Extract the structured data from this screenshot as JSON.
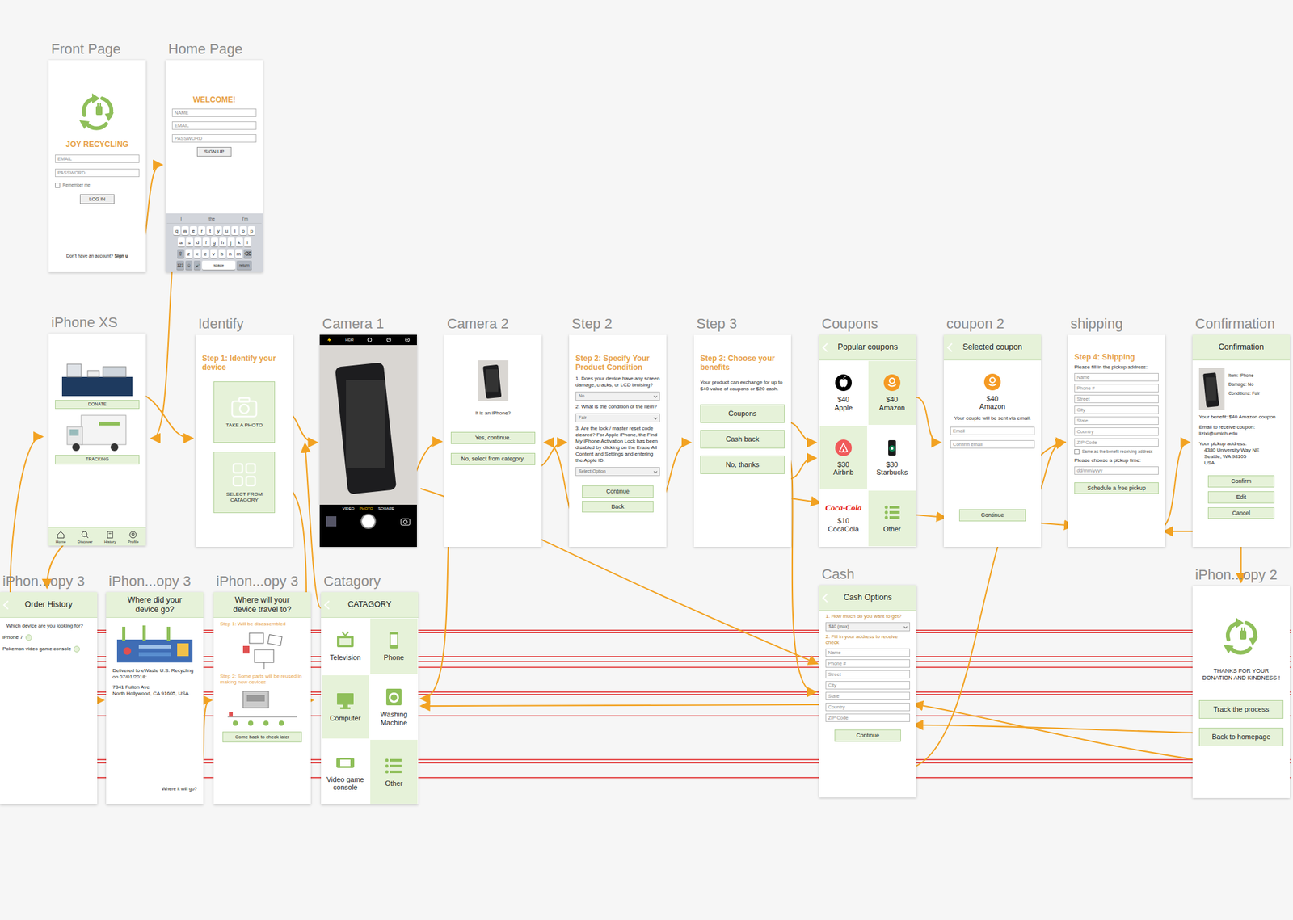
{
  "canvas": {
    "artboards": [
      {
        "label": "Front Page",
        "blocks": [
          {
            "kind": "logo"
          },
          {
            "kind": "heading",
            "text": "JOY RECYCLING"
          },
          {
            "kind": "input",
            "placeholder": "EMAIL"
          },
          {
            "kind": "input",
            "placeholder": "PASSWORD"
          },
          {
            "kind": "checkbox",
            "text": "Remember me",
            "checked": false
          },
          {
            "kind": "button",
            "text": "LOG IN"
          },
          {
            "kind": "link",
            "text": "Don't have an account? ",
            "strong": "Sign u"
          }
        ]
      },
      {
        "label": "Home Page",
        "blocks": [
          {
            "kind": "heading",
            "text": "WELCOME!"
          },
          {
            "kind": "input",
            "placeholder": "NAME"
          },
          {
            "kind": "input",
            "placeholder": "EMAIL"
          },
          {
            "kind": "input",
            "placeholder": "PASSWORD"
          },
          {
            "kind": "button",
            "text": "SIGN UP"
          },
          {
            "kind": "keyboard",
            "suggestions": [
              "I",
              "the",
              "I'm"
            ],
            "rows": [
              [
                "q",
                "w",
                "e",
                "r",
                "t",
                "y",
                "u",
                "i",
                "o",
                "p"
              ],
              [
                "a",
                "s",
                "d",
                "f",
                "g",
                "h",
                "j",
                "k",
                "l"
              ],
              [
                "⇧",
                "z",
                "x",
                "c",
                "v",
                "b",
                "n",
                "m",
                "⌫"
              ]
            ],
            "bottom": [
              "123",
              "☺",
              "🎤",
              "space",
              "return"
            ]
          }
        ]
      },
      {
        "label": "iPhone XS",
        "blocks": [
          {
            "kind": "illustration"
          },
          {
            "kind": "button",
            "text": "DONATE"
          },
          {
            "kind": "illustration"
          },
          {
            "kind": "button",
            "text": "TRACKING"
          },
          {
            "kind": "tabbar",
            "items": [
              "Home",
              "Discover",
              "History",
              "Profile"
            ]
          }
        ]
      },
      {
        "label": "Identify",
        "blocks": [
          {
            "kind": "heading",
            "text": "Step 1: Identify your device"
          },
          {
            "kind": "tile",
            "text": "TAKE A PHOTO"
          },
          {
            "kind": "tile",
            "text": "SELECT FROM CATAGORY"
          }
        ]
      },
      {
        "label": "Camera 1",
        "blocks": [
          {
            "kind": "camera",
            "hdr": "HDR",
            "modes": [
              {
                "label": "VIDEO",
                "selected": false
              },
              {
                "label": "PHOTO",
                "selected": true
              },
              {
                "label": "SQUARE",
                "selected": false
              }
            ]
          }
        ]
      },
      {
        "label": "Camera 2",
        "blocks": [
          {
            "kind": "photo"
          },
          {
            "kind": "text",
            "text": "It is an iPhone?"
          },
          {
            "kind": "button",
            "text": "Yes, continue."
          },
          {
            "kind": "button",
            "text": "No, select from category."
          }
        ]
      },
      {
        "label": "Step 2",
        "blocks": [
          {
            "kind": "heading",
            "text": "Step 2: Specify Your Product Condition"
          },
          {
            "kind": "text",
            "text": "1. Does your device have any screen damage, cracks, or LCD bruising?"
          },
          {
            "kind": "select",
            "value": "No"
          },
          {
            "kind": "text",
            "text": "2. What is the condition of the item?"
          },
          {
            "kind": "select",
            "value": "Fair"
          },
          {
            "kind": "text",
            "text": "3. Are the lock / master reset code cleared? For Apple iPhone, the Find My iPhone Activation Lock has been disabled by clicking on the Erase All Content and Settings and entering the Apple ID."
          },
          {
            "kind": "select",
            "value": "Select Option"
          },
          {
            "kind": "button",
            "text": "Continue"
          },
          {
            "kind": "button",
            "text": "Back"
          }
        ]
      },
      {
        "label": "Step 3",
        "blocks": [
          {
            "kind": "heading",
            "text": "Step 3: Choose your benefits"
          },
          {
            "kind": "text",
            "text": "Your product can exchange for up to $40 value of coupons or $20 cash."
          },
          {
            "kind": "bigbutton",
            "text": "Coupons"
          },
          {
            "kind": "bigbutton",
            "text": "Cash back"
          },
          {
            "kind": "bigbutton",
            "text": "No, thanks"
          }
        ]
      },
      {
        "label": "Coupons",
        "blocks": [
          {
            "kind": "header",
            "text": "Popular coupons",
            "back": true
          },
          {
            "kind": "coupons",
            "items": [
              {
                "price": "$40",
                "label": "Apple"
              },
              {
                "price": "$40",
                "label": "Amazon"
              },
              {
                "price": "$30",
                "label": "Airbnb"
              },
              {
                "price": "$30",
                "label": "Starbucks"
              },
              {
                "price": "$10",
                "label": "CocaCola",
                "logo_text": "Coca-Cola"
              },
              {
                "label": "Other"
              }
            ]
          }
        ]
      },
      {
        "label": "coupon 2",
        "blocks": [
          {
            "kind": "header",
            "text": "Selected coupon",
            "back": true
          },
          {
            "kind": "coupon",
            "price": "$40",
            "label": "Amazon"
          },
          {
            "kind": "text",
            "text": "Your couple will be sent via email."
          },
          {
            "kind": "input",
            "placeholder": "Email"
          },
          {
            "kind": "input",
            "placeholder": "Confirm email"
          },
          {
            "kind": "button",
            "text": "Continue"
          }
        ]
      },
      {
        "label": "shipping",
        "blocks": [
          {
            "kind": "heading",
            "text": "Step 4: Shipping"
          },
          {
            "kind": "text",
            "text": "Please fill in the pickup address:"
          },
          {
            "kind": "input",
            "placeholder": "Name"
          },
          {
            "kind": "input",
            "placeholder": "Phone #"
          },
          {
            "kind": "input",
            "placeholder": "Street"
          },
          {
            "kind": "input",
            "placeholder": "City"
          },
          {
            "kind": "input",
            "placeholder": "State"
          },
          {
            "kind": "input",
            "placeholder": "Country"
          },
          {
            "kind": "input",
            "placeholder": "ZIP Code"
          },
          {
            "kind": "checkbox",
            "text": "Same as the benefit receiving address",
            "checked": false
          },
          {
            "kind": "text",
            "text": "Please choose a pickup time:"
          },
          {
            "kind": "input",
            "placeholder": "dd/mm/yyyy"
          },
          {
            "kind": "button",
            "text": "Schedule a free pickup"
          }
        ]
      },
      {
        "label": "Confirmation",
        "blocks": [
          {
            "kind": "header",
            "text": "Confirmation",
            "back": false
          },
          {
            "kind": "summary",
            "lines": [
              "Item: iPhone",
              "Damage: No",
              "Conditions: Fair"
            ]
          },
          {
            "kind": "text",
            "text": "Your benefit: $40 Amazon coupon"
          },
          {
            "kind": "text",
            "text": "Email to receive coupon: lizixi@umich.edu"
          },
          {
            "kind": "address",
            "title": "Your pickup address:",
            "lines": [
              "4380 University Way NE",
              "Seattle, WA 98105",
              "USA"
            ]
          },
          {
            "kind": "button",
            "text": "Confirm"
          },
          {
            "kind": "button",
            "text": "Edit"
          },
          {
            "kind": "button",
            "text": "Cancel"
          }
        ]
      },
      {
        "label": "iPhon...opy 3",
        "blocks": [
          {
            "kind": "header",
            "text": "Order History",
            "back": true
          },
          {
            "kind": "text",
            "text": "Which device are you looking for?"
          },
          {
            "kind": "radio",
            "text": "iPhone 7",
            "selected": false
          },
          {
            "kind": "radio",
            "text": "Pokemon video game console",
            "selected": false
          }
        ]
      },
      {
        "label": "iPhon...opy 3",
        "blocks": [
          {
            "kind": "header",
            "text": "Where did your device go?",
            "back": false
          },
          {
            "kind": "illustration"
          },
          {
            "kind": "text",
            "text": "Delivered to eWaste U.S. Recycling on 07/01/2018:"
          },
          {
            "kind": "address",
            "title": "7341 Fulton Ave",
            "lines": [
              "North Hollywood, CA 91605, USA"
            ]
          },
          {
            "kind": "note",
            "text": "Where it will go?"
          }
        ]
      },
      {
        "label": "iPhon...opy 3",
        "blocks": [
          {
            "kind": "header",
            "text": "Where will your device travel to?",
            "back": false
          },
          {
            "kind": "subheading",
            "text": "Step 1: Will be disassembled"
          },
          {
            "kind": "illustration"
          },
          {
            "kind": "subheading",
            "text": "Step 2: Some parts will be reused in making new devices"
          },
          {
            "kind": "illustration"
          },
          {
            "kind": "button",
            "text": "Come back to check later"
          }
        ]
      },
      {
        "label": "Catagory",
        "blocks": [
          {
            "kind": "header",
            "text": "CATAGORY",
            "back": true
          },
          {
            "kind": "categories",
            "items": [
              "Television",
              "Phone",
              "Computer",
              "Washing Machine",
              "Video game console",
              "Other"
            ]
          }
        ]
      },
      {
        "label": "Cash",
        "blocks": [
          {
            "kind": "header",
            "text": "Cash Options",
            "back": true
          },
          {
            "kind": "subheading",
            "text": "1. How much do you want to get?"
          },
          {
            "kind": "select",
            "value": "$40 (max)"
          },
          {
            "kind": "subheading",
            "text": "2. Fill in your address to receive check"
          },
          {
            "kind": "input",
            "placeholder": "Name"
          },
          {
            "kind": "input",
            "placeholder": "Phone #"
          },
          {
            "kind": "input",
            "placeholder": "Street"
          },
          {
            "kind": "input",
            "placeholder": "City"
          },
          {
            "kind": "input",
            "placeholder": "State"
          },
          {
            "kind": "input",
            "placeholder": "Country"
          },
          {
            "kind": "input",
            "placeholder": "ZIP Code"
          },
          {
            "kind": "button",
            "text": "Continue"
          }
        ]
      },
      {
        "label": "iPhon...opy 2",
        "blocks": [
          {
            "kind": "logo"
          },
          {
            "kind": "text",
            "text": "THANKS FOR YOUR DONATION AND KINDNESS !"
          },
          {
            "kind": "bigbutton",
            "text": "Track the process"
          },
          {
            "kind": "bigbutton",
            "text": "Back to homepage"
          }
        ]
      }
    ]
  }
}
